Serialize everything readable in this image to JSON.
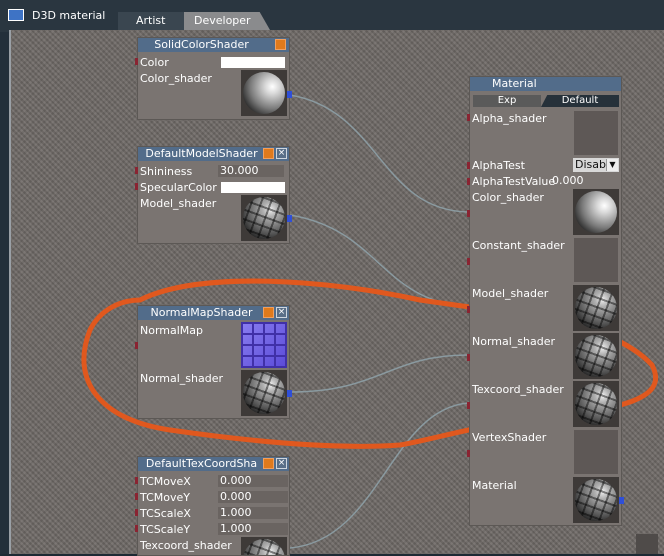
{
  "window": {
    "title": "D3D material"
  },
  "tabs": [
    {
      "label": "Artist"
    },
    {
      "label": "Developer"
    }
  ],
  "colors": {
    "annotation_stroke": "#e0581e",
    "port_in": "#8a2432",
    "port_out": "#2f4fd8",
    "header": "#526c8a"
  },
  "nodes": {
    "solid_color": {
      "title": "SolidColorShader",
      "rows": {
        "color": "Color",
        "color_shader": "Color_shader"
      }
    },
    "default_model": {
      "title": "DefaultModelShader",
      "rows": {
        "shininess": "Shininess",
        "shininess_value": "30.000",
        "specular": "SpecularColor",
        "model_shader": "Model_shader"
      },
      "close": "×"
    },
    "normal_map": {
      "title": "NormalMapShader",
      "rows": {
        "normal_map": "NormalMap",
        "normal_shader": "Normal_shader"
      },
      "close": "×"
    },
    "tex_coord": {
      "title": "DefaultTexCoordSha",
      "close": "×",
      "rows": [
        {
          "label": "TCMoveX",
          "value": "0.000"
        },
        {
          "label": "TCMoveY",
          "value": "0.000"
        },
        {
          "label": "TCScaleX",
          "value": "1.000"
        },
        {
          "label": "TCScaleY",
          "value": "1.000"
        }
      ],
      "output": "Texcoord_shader"
    },
    "material": {
      "title": "Material",
      "sub_tabs": {
        "exp": "Exp",
        "default": "Default"
      },
      "rows": {
        "alpha_shader": "Alpha_shader",
        "alpha_test": "AlphaTest",
        "alpha_test_value_label": "AlphaTestValue",
        "alpha_test_value": "0.000",
        "color_shader": "Color_shader",
        "constant_shader": "Constant_shader",
        "model_shader": "Model_shader",
        "normal_shader": "Normal_shader",
        "texcoord_shader": "Texcoord_shader",
        "vertex_shader": "VertexShader",
        "material": "Material"
      },
      "alpha_test_dropdown": {
        "selected": "Disabl",
        "arrow": "▼"
      }
    }
  }
}
